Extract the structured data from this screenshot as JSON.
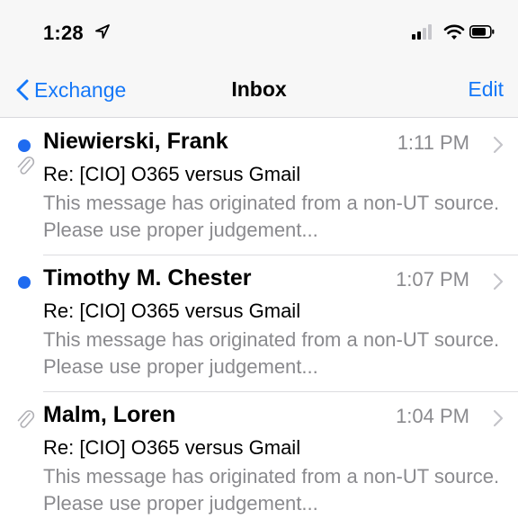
{
  "status": {
    "time": "1:28"
  },
  "nav": {
    "back_label": "Exchange",
    "title": "Inbox",
    "edit_label": "Edit"
  },
  "messages": [
    {
      "sender": "Niewierski, Frank",
      "time": "1:11 PM",
      "subject": "Re: [CIO] O365 versus Gmail",
      "preview": "This message has originated from a non-UT source. Please use proper judgement...",
      "unread": true,
      "attachment": true
    },
    {
      "sender": "Timothy M. Chester",
      "time": "1:07 PM",
      "subject": "Re: [CIO] O365 versus Gmail",
      "preview": "This message has originated from a non-UT source. Please use proper judgement...",
      "unread": true,
      "attachment": false
    },
    {
      "sender": "Malm, Loren",
      "time": "1:04 PM",
      "subject": "Re: [CIO] O365 versus Gmail",
      "preview": "This message has originated from a non-UT source. Please use proper judgement...",
      "unread": false,
      "attachment": true
    }
  ],
  "colors": {
    "accent": "#1477f8",
    "unread_dot": "#1f6bf0",
    "secondary_text": "#8a8a8e"
  }
}
